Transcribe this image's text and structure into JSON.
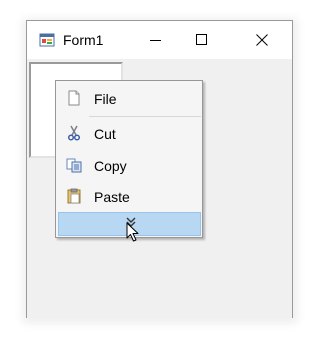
{
  "window": {
    "title": "Form1",
    "app_icon": "form-app-icon",
    "buttons": {
      "minimize_icon": "minimize-icon",
      "maximize_icon": "maximize-icon",
      "close_icon": "close-icon"
    }
  },
  "context_menu": {
    "items": [
      {
        "label": "File",
        "icon": "file-icon"
      },
      {
        "label": "Cut",
        "icon": "scissors-icon"
      },
      {
        "label": "Copy",
        "icon": "copy-icon"
      },
      {
        "label": "Paste",
        "icon": "paste-icon"
      }
    ],
    "overflow_icon": "double-chevron-down-icon",
    "highlight_color": "#b8d7f2"
  }
}
